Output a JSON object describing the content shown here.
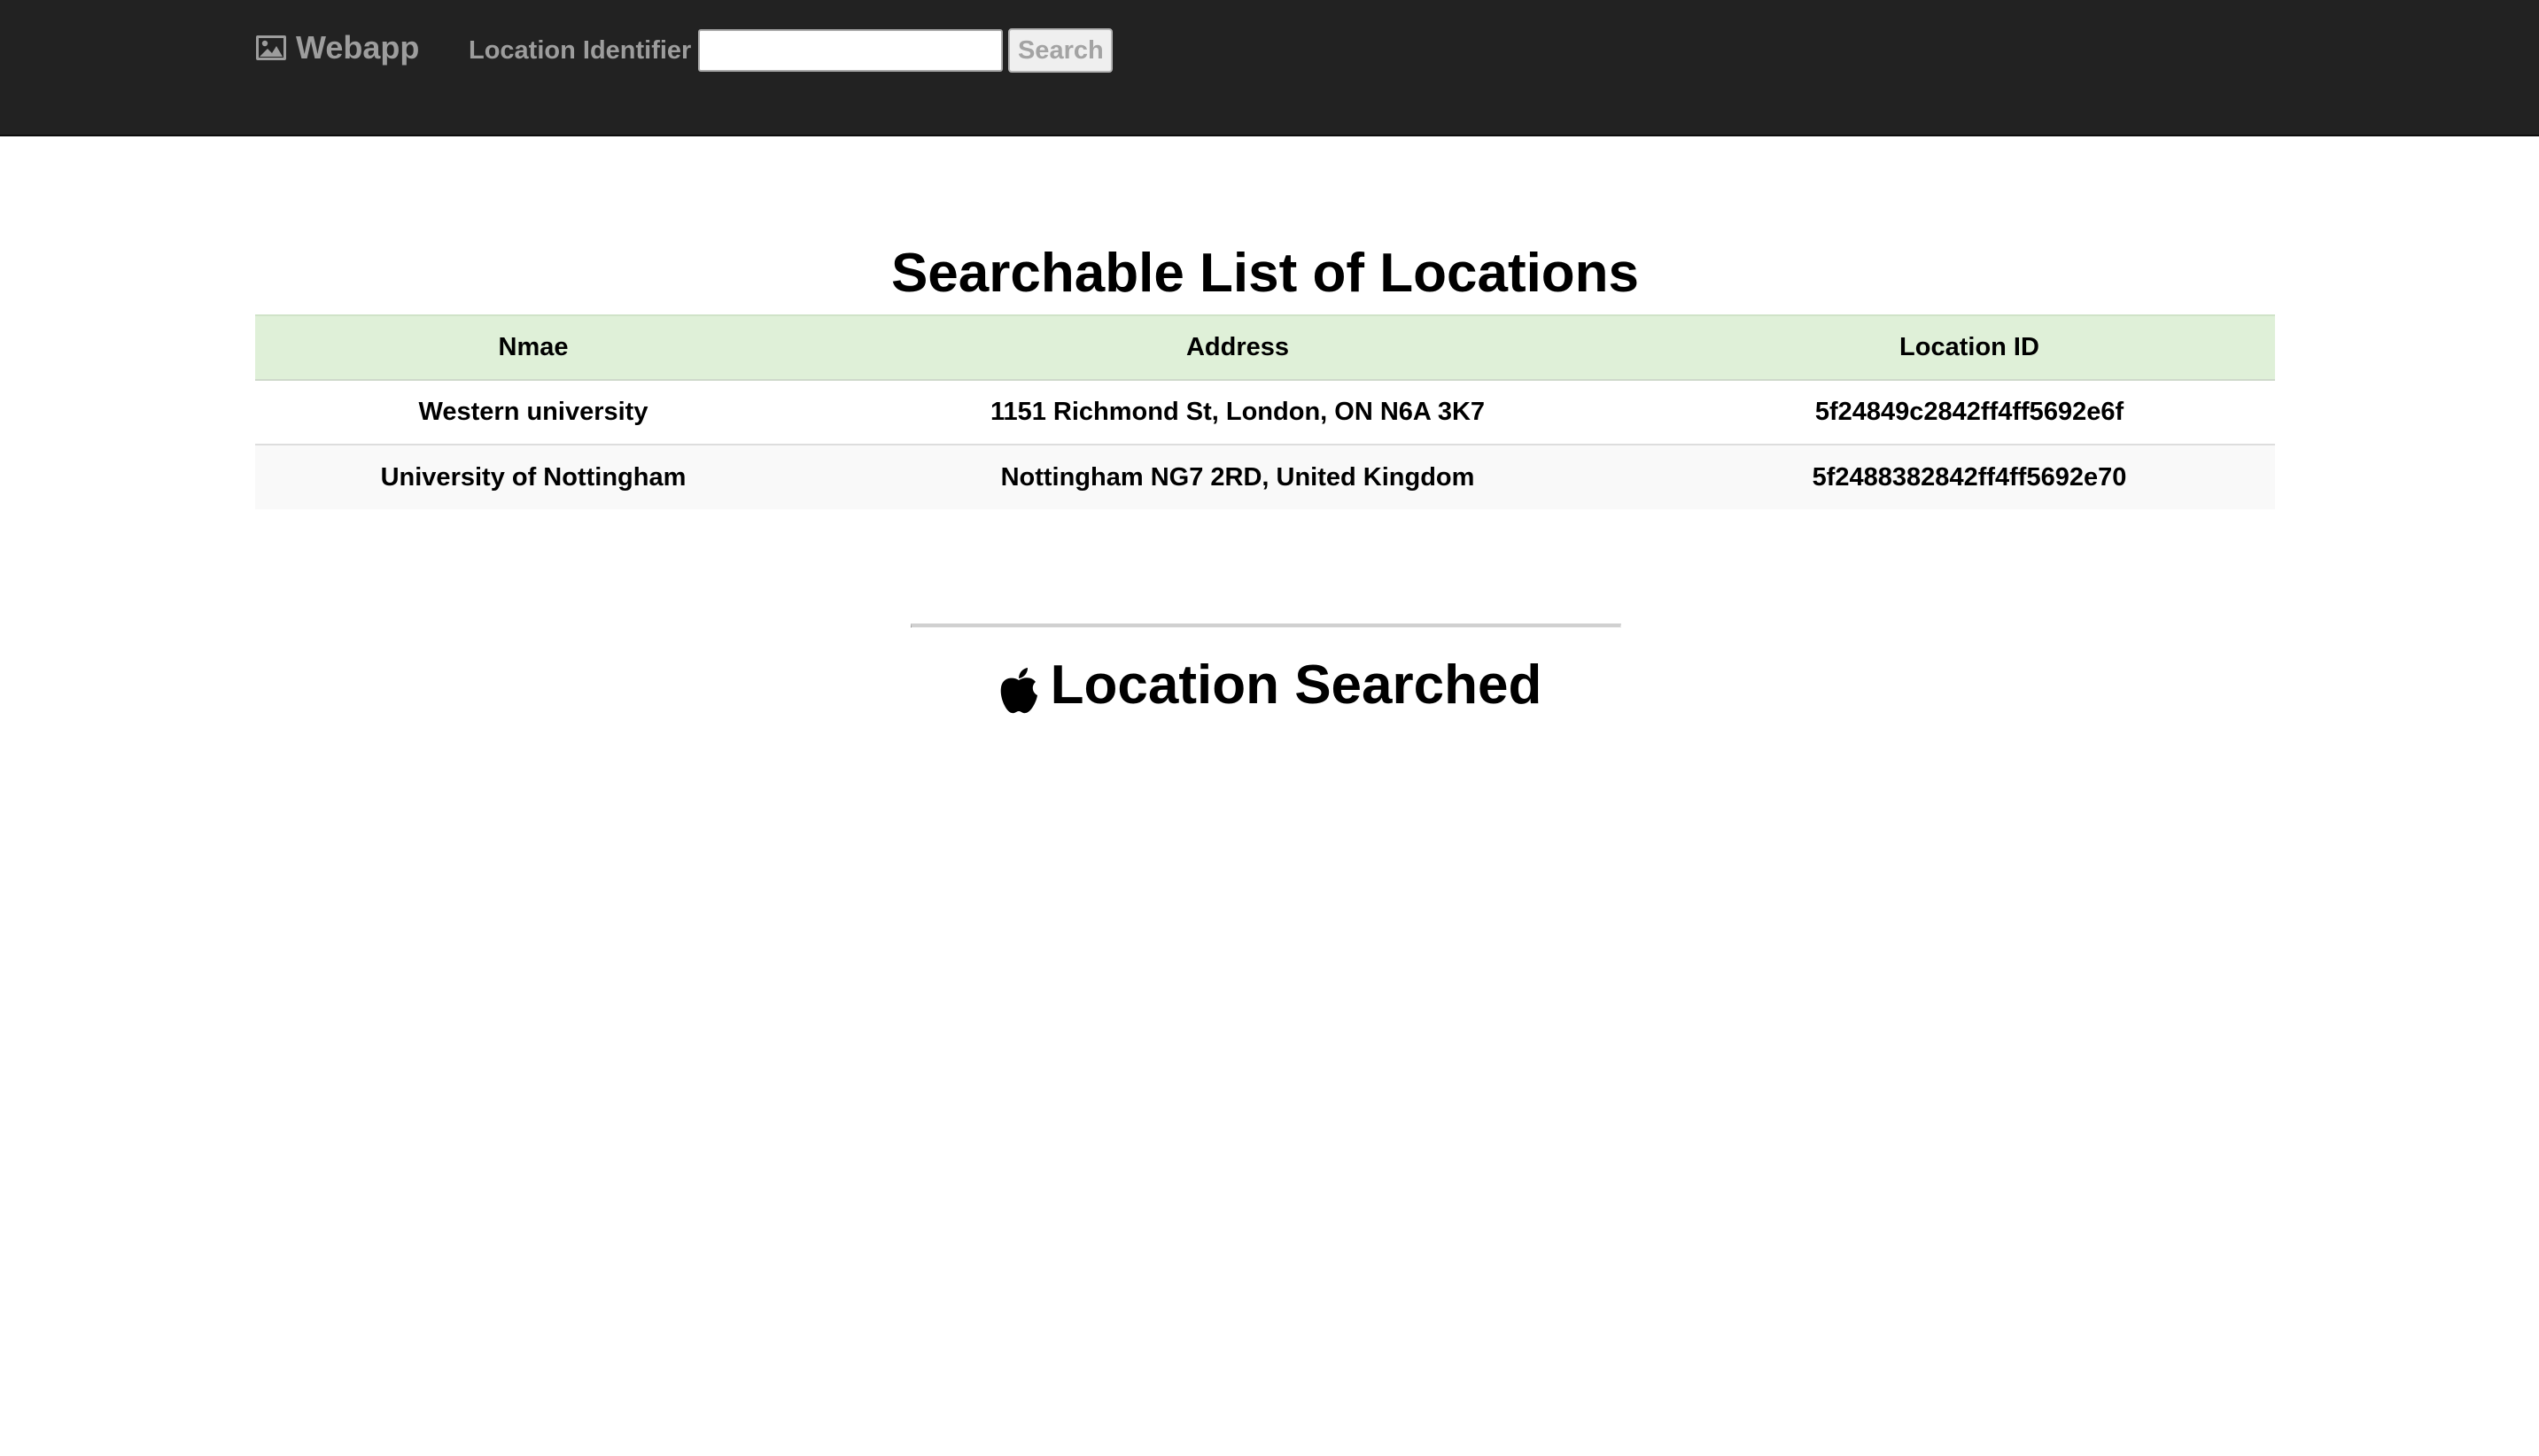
{
  "navbar": {
    "brand_label": "Webapp",
    "brand_icon": "picture-icon",
    "search_label": "Location Identifier",
    "search_value": "",
    "search_button_label": "Search",
    "background_color": "#222222",
    "text_color": "#9d9d9d"
  },
  "main": {
    "title": "Searchable List of Locations",
    "table": {
      "header_color": "#dff0d8",
      "columns": [
        "Nmae",
        "Address",
        "Location ID"
      ],
      "rows": [
        {
          "name": "Western university",
          "address": "1151 Richmond St, London, ON N6A 3K7",
          "location_id": "5f24849c2842ff4ff5692e6f"
        },
        {
          "name": "University of Nottingham",
          "address": "Nottingham NG7 2RD, United Kingdom",
          "location_id": "5f2488382842ff4ff5692e70"
        }
      ]
    },
    "searched_title": "Location Searched",
    "searched_icon": "apple-icon"
  }
}
